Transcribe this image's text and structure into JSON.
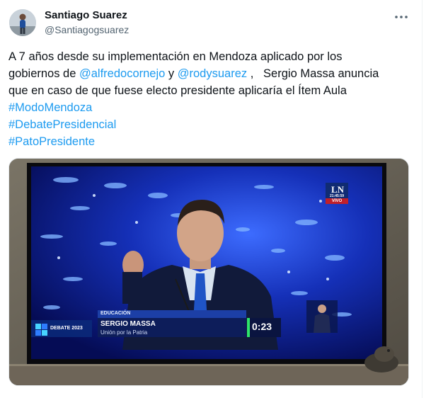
{
  "author": {
    "name": "Santiago Suarez",
    "handle": "@Santiagogsuarez"
  },
  "tweet": {
    "line1": "A 7 años desde su implementación en Mendoza aplicado por los",
    "line2_pre": "gobiernos de ",
    "mention1": "@alfredocornejo",
    "line2_mid": " y ",
    "mention2": "@rodysuarez",
    "line2_post": " ,   Sergio Massa anuncia",
    "line3": "que en caso de que fuese electo presidente aplicaría el Ítem Aula",
    "hashtags": [
      "#ModoMendoza",
      "#DebatePresidencial",
      "#PatoPresidente"
    ]
  },
  "tv": {
    "channel_logo": "LN",
    "channel_live": "VIVO",
    "channel_time": "21:45:59",
    "section": "EDUCACIÓN",
    "speaker_name": "SERGIO MASSA",
    "speaker_party": "Unión por la Patria",
    "timer": "0:23",
    "event_label": "DEBATE 2023"
  },
  "icons": {
    "more": "more-horizontal-icon",
    "debate_logo": "debate-logo-icon"
  }
}
